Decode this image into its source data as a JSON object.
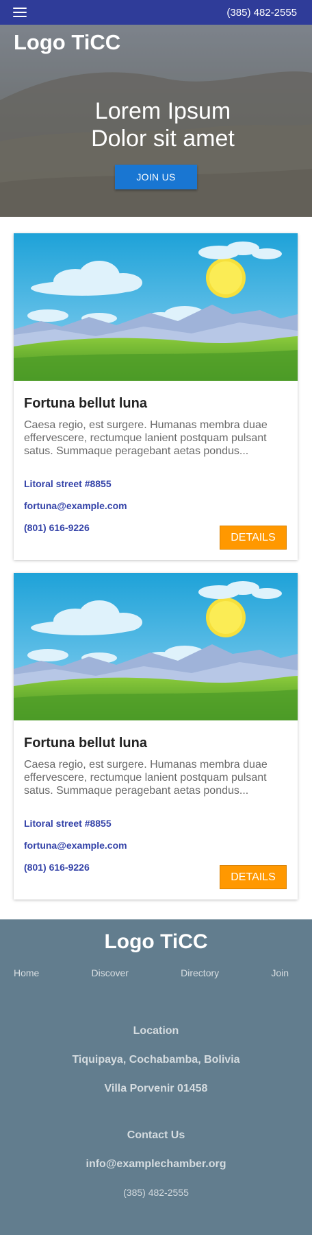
{
  "header": {
    "menu_icon": "hamburger-menu-icon",
    "phone": "(385) 482-2555"
  },
  "hero": {
    "logo": "Logo TiCC",
    "title_line1": "Lorem Ipsum",
    "title_line2": "Dolor sit amet",
    "cta_label": "JOIN US"
  },
  "cards": [
    {
      "title": "Fortuna bellut luna",
      "description": "Caesa regio, est surgere. Humanas membra duae effervescere, rectumque lanient postquam pulsant satus. Summaque peragebant aetas pondus...",
      "address": "Litoral street #8855",
      "email": "fortuna@example.com",
      "phone": "(801) 616-9226",
      "details_label": "DETAILS"
    },
    {
      "title": "Fortuna bellut luna",
      "description": "Caesa regio, est surgere. Humanas membra duae effervescere, rectumque lanient postquam pulsant satus. Summaque peragebant aetas pondus...",
      "address": "Litoral street #8855",
      "email": "fortuna@example.com",
      "phone": "(801) 616-9226",
      "details_label": "DETAILS"
    }
  ],
  "footer": {
    "logo": "Logo TiCC",
    "nav": [
      "Home",
      "Discover",
      "Directory",
      "Join"
    ],
    "location_heading": "Location",
    "location_line1": "Tiquipaya, Cochabamba, Bolivia",
    "location_line2": "Villa Porvenir 01458",
    "contact_heading": "Contact Us",
    "contact_email": "info@examplechamber.org",
    "contact_phone": "(385) 482-2555"
  },
  "colors": {
    "header_bg": "#2f3c99",
    "primary_button": "#1976d2",
    "details_button": "#ff9800",
    "link": "#3342a8",
    "footer_bg": "#627d8e"
  }
}
